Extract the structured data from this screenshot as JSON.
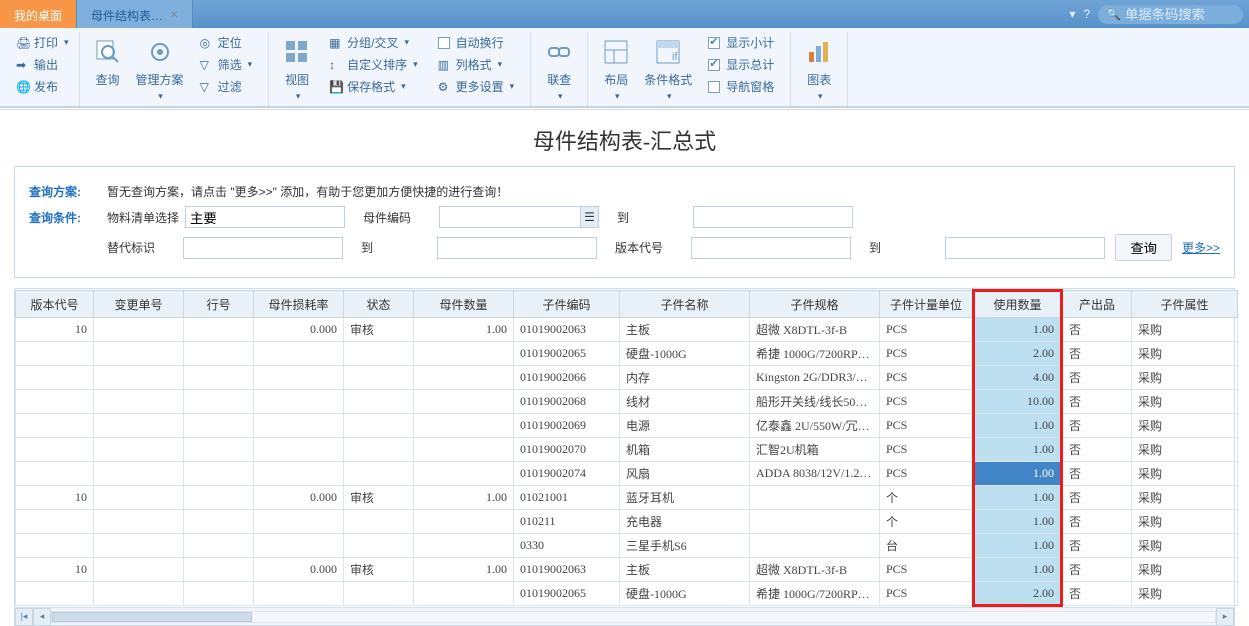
{
  "top": {
    "tab_desktop": "我的桌面",
    "tab_doc": "母件结构表…",
    "search_placeholder": "单据条码搜索"
  },
  "ribbon": {
    "print": "打印",
    "output": "输出",
    "publish": "发布",
    "query": "查询",
    "plan": "管理方案",
    "locate": "定位",
    "filter": "筛选",
    "clearfilter": "过滤",
    "view": "视图",
    "group": "分组/交叉",
    "custom_sort": "自定义排序",
    "save_format": "保存格式",
    "autowrap": "自动换行",
    "colformat": "列格式",
    "more_set": "更多设置",
    "link": "联查",
    "layout": "布局",
    "cond_fmt": "条件格式",
    "show_sub": "显示小计",
    "show_total": "显示总计",
    "nav_pane": "导航窗格",
    "chart": "图表"
  },
  "title": "母件结构表-汇总式",
  "query_panel": {
    "plan_label": "查询方案:",
    "plan_hint": "暂无查询方案，请点击 \"更多>>\" 添加，有助于您更加方便快捷的进行查询！",
    "cond_label": "查询条件:",
    "bom_sel_label": "物料清单选择",
    "bom_sel_value": "主要",
    "parent_code_label": "母件编码",
    "to_label": "到",
    "sub_label": "替代标识",
    "ver_label": "版本代号",
    "btn_query": "查询",
    "more": "更多>>",
    "parent_code_value": "",
    "to1_value": "",
    "sub_value": "",
    "to2_value": "",
    "ver_value": "",
    "to3_value": ""
  },
  "grid": {
    "headers": {
      "ver": "版本代号",
      "chg": "变更单号",
      "rownum": "行号",
      "loss": "母件损耗率",
      "state": "状态",
      "pqty": "母件数量",
      "ccode": "子件编码",
      "cname": "子件名称",
      "cspec": "子件规格",
      "cunit": "子件计量单位",
      "useqty": "使用数量",
      "output": "产出品",
      "cattr": "子件属性"
    },
    "rows": [
      {
        "ver": "10",
        "chg": "",
        "rownum": "",
        "loss": "0.000",
        "state": "审核",
        "pqty": "1.00",
        "ccode": "01019002063",
        "cname": "主板",
        "cspec": "超微 X8DTL-3f-B",
        "cunit": "PCS",
        "useqty": "1.00",
        "output": "否",
        "cattr": "采购"
      },
      {
        "ver": "",
        "chg": "",
        "rownum": "",
        "loss": "",
        "state": "",
        "pqty": "",
        "ccode": "01019002065",
        "cname": "硬盘-1000G",
        "cspec": "希捷 1000G/7200RP…",
        "cunit": "PCS",
        "useqty": "2.00",
        "output": "否",
        "cattr": "采购"
      },
      {
        "ver": "",
        "chg": "",
        "rownum": "",
        "loss": "",
        "state": "",
        "pqty": "",
        "ccode": "01019002066",
        "cname": "内存",
        "cspec": "Kingston 2G/DDR3/…",
        "cunit": "PCS",
        "useqty": "4.00",
        "output": "否",
        "cattr": "采购"
      },
      {
        "ver": "",
        "chg": "",
        "rownum": "",
        "loss": "",
        "state": "",
        "pqty": "",
        "ccode": "01019002068",
        "cname": "线材",
        "cspec": "船形开关线/线长50…",
        "cunit": "PCS",
        "useqty": "10.00",
        "output": "否",
        "cattr": "采购"
      },
      {
        "ver": "",
        "chg": "",
        "rownum": "",
        "loss": "",
        "state": "",
        "pqty": "",
        "ccode": "01019002069",
        "cname": "电源",
        "cspec": "亿泰鑫 2U/550W/冗…",
        "cunit": "PCS",
        "useqty": "1.00",
        "output": "否",
        "cattr": "采购"
      },
      {
        "ver": "",
        "chg": "",
        "rownum": "",
        "loss": "",
        "state": "",
        "pqty": "",
        "ccode": "01019002070",
        "cname": "机箱",
        "cspec": "汇智2U机箱",
        "cunit": "PCS",
        "useqty": "1.00",
        "output": "否",
        "cattr": "采购"
      },
      {
        "ver": "",
        "chg": "",
        "rownum": "",
        "loss": "",
        "state": "",
        "pqty": "",
        "ccode": "01019002074",
        "cname": "风扇",
        "cspec": "ADDA 8038/12V/1.2…",
        "cunit": "PCS",
        "useqty": "1.00",
        "output": "否",
        "cattr": "采购",
        "focused": true
      },
      {
        "ver": "10",
        "chg": "",
        "rownum": "",
        "loss": "0.000",
        "state": "审核",
        "pqty": "1.00",
        "ccode": "01021001",
        "cname": "蓝牙耳机",
        "cspec": "",
        "cunit": "个",
        "useqty": "1.00",
        "output": "否",
        "cattr": "采购"
      },
      {
        "ver": "",
        "chg": "",
        "rownum": "",
        "loss": "",
        "state": "",
        "pqty": "",
        "ccode": "010211",
        "cname": "充电器",
        "cspec": "",
        "cunit": "个",
        "useqty": "1.00",
        "output": "否",
        "cattr": "采购"
      },
      {
        "ver": "",
        "chg": "",
        "rownum": "",
        "loss": "",
        "state": "",
        "pqty": "",
        "ccode": "0330",
        "cname": "三星手机S6",
        "cspec": "",
        "cunit": "台",
        "useqty": "1.00",
        "output": "否",
        "cattr": "采购"
      },
      {
        "ver": "10",
        "chg": "",
        "rownum": "",
        "loss": "0.000",
        "state": "审核",
        "pqty": "1.00",
        "ccode": "01019002063",
        "cname": "主板",
        "cspec": "超微 X8DTL-3f-B",
        "cunit": "PCS",
        "useqty": "1.00",
        "output": "否",
        "cattr": "采购"
      },
      {
        "ver": "",
        "chg": "",
        "rownum": "",
        "loss": "",
        "state": "",
        "pqty": "",
        "ccode": "01019002065",
        "cname": "硬盘-1000G",
        "cspec": "希捷 1000G/7200RP…",
        "cunit": "PCS",
        "useqty": "2.00",
        "output": "否",
        "cattr": "采购"
      }
    ]
  }
}
